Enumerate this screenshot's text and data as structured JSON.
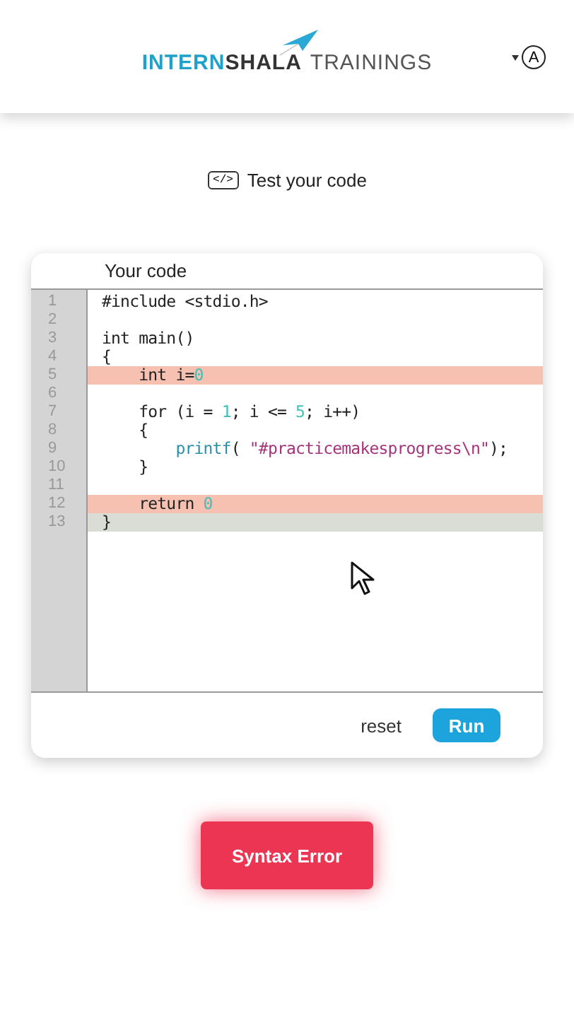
{
  "header": {
    "logo": [
      {
        "text": "INTERN",
        "kind": "brand"
      },
      {
        "text": "SHALA",
        "kind": "dark"
      },
      {
        "text": "TRAININGS",
        "kind": "light"
      }
    ],
    "account": {
      "initial": "A"
    }
  },
  "section": {
    "icon_text": "</>",
    "title": "Test your code"
  },
  "editor": {
    "title": "Your code",
    "lines": [
      {
        "number": "1",
        "error": false,
        "current": false,
        "tokens": [
          {
            "text": "#include <stdio.h>",
            "kind": "plain"
          }
        ]
      },
      {
        "number": "2",
        "error": false,
        "current": false
      },
      {
        "number": "3",
        "error": false,
        "current": false,
        "tokens": [
          {
            "text": "int main()",
            "kind": "plain"
          }
        ]
      },
      {
        "number": "4",
        "error": false,
        "current": false,
        "tokens": [
          {
            "text": "{",
            "kind": "plain"
          }
        ]
      },
      {
        "number": "5",
        "error": true,
        "current": false,
        "tokens": [
          {
            "text": "    int i=",
            "kind": "plain"
          },
          {
            "text": "0",
            "kind": "number"
          }
        ]
      },
      {
        "number": "6",
        "error": false,
        "current": false
      },
      {
        "number": "7",
        "error": false,
        "current": false,
        "tokens": [
          {
            "text": "    for (i = ",
            "kind": "plain"
          },
          {
            "text": "1",
            "kind": "number"
          },
          {
            "text": "; i <= ",
            "kind": "plain"
          },
          {
            "text": "5",
            "kind": "number"
          },
          {
            "text": "; i++)",
            "kind": "plain"
          }
        ]
      },
      {
        "number": "8",
        "error": false,
        "current": false,
        "tokens": [
          {
            "text": "    {",
            "kind": "plain"
          }
        ]
      },
      {
        "number": "9",
        "error": false,
        "current": false,
        "tokens": [
          {
            "text": "        printf",
            "kind": "func"
          },
          {
            "text": "( ",
            "kind": "plain"
          },
          {
            "text": "\"#practicemakesprogress\\n\"",
            "kind": "string"
          },
          {
            "text": ");",
            "kind": "plain"
          }
        ]
      },
      {
        "number": "10",
        "error": false,
        "current": false,
        "tokens": [
          {
            "text": "    }",
            "kind": "plain"
          }
        ]
      },
      {
        "number": "11",
        "error": false,
        "current": false
      },
      {
        "number": "12",
        "error": true,
        "current": false,
        "tokens": [
          {
            "text": "    return ",
            "kind": "plain"
          },
          {
            "text": "0",
            "kind": "number"
          }
        ]
      },
      {
        "number": "13",
        "error": false,
        "current": true,
        "tokens": [
          {
            "text": "}",
            "kind": "plain"
          }
        ]
      }
    ],
    "reset_label": "reset",
    "run_label": "Run"
  },
  "result": {
    "label": "Syntax Error",
    "failed": true
  }
}
